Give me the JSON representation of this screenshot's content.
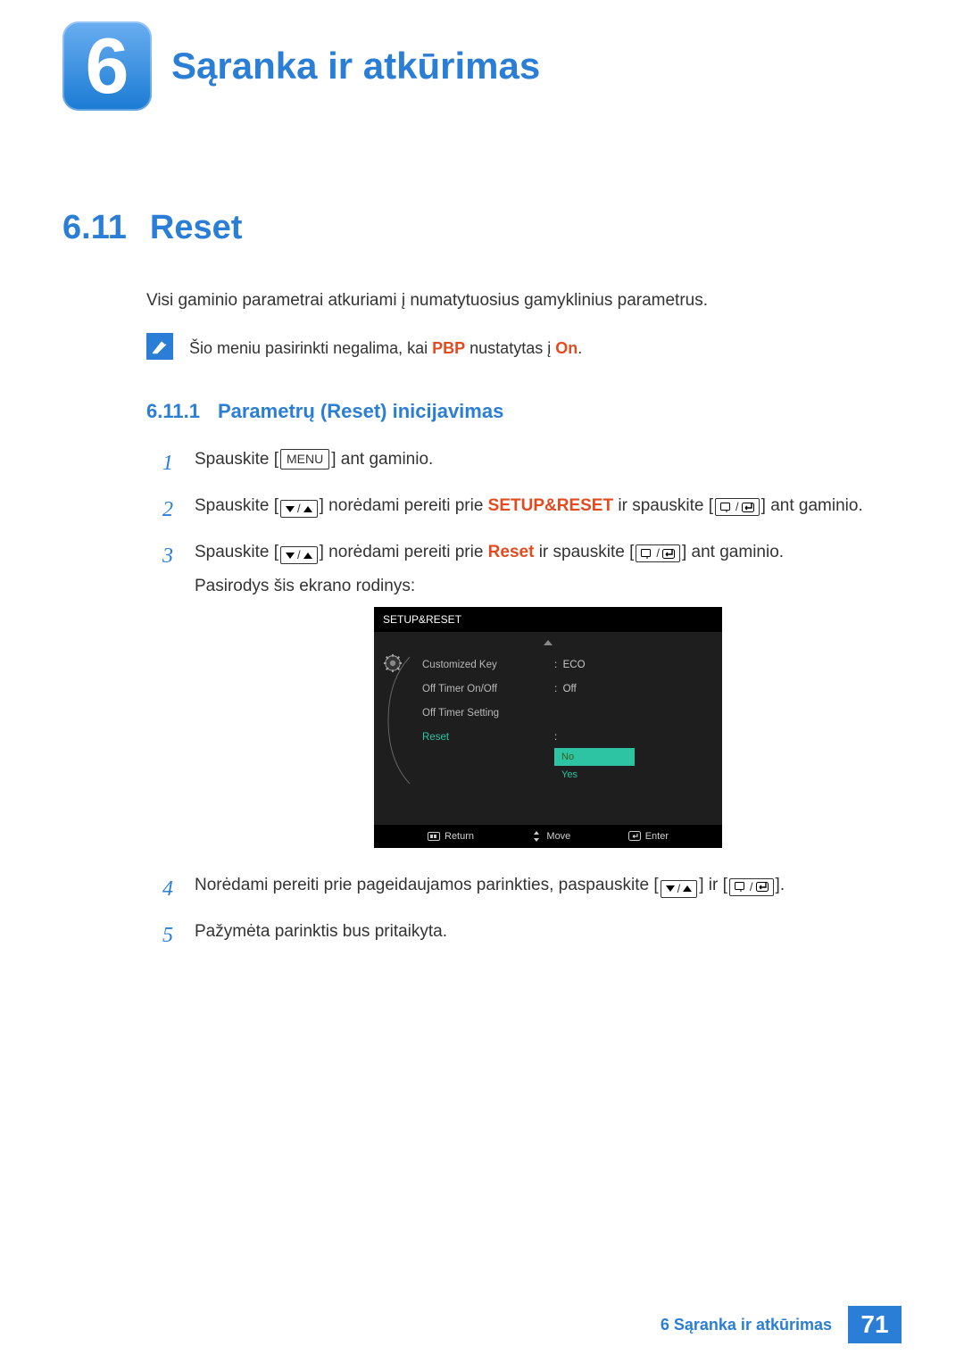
{
  "chapter": {
    "number": "6",
    "title": "Sąranka ir atkūrimas"
  },
  "section": {
    "number": "6.11",
    "title": "Reset"
  },
  "intro": "Visi gaminio parametrai atkuriami į numatytuosius gamyklinius parametrus.",
  "note": {
    "prefix": "Šio meniu pasirinkti negalima, kai ",
    "pbp": "PBP",
    "mid": " nustatytas į ",
    "on": "On",
    "suffix": "."
  },
  "subsection": {
    "number": "6.11.1",
    "title": "Parametrų (Reset) inicijavimas"
  },
  "buttons": {
    "menu": "MENU"
  },
  "steps": {
    "s1_a": "Spauskite [",
    "s1_b": "] ant gaminio.",
    "s2_a": "Spauskite [",
    "s2_b": "] norėdami pereiti prie ",
    "s2_kw": "SETUP&RESET",
    "s2_c": " ir spauskite [",
    "s2_d": "] ant gaminio.",
    "s3_a": "Spauskite [",
    "s3_b": "] norėdami pereiti prie ",
    "s3_kw": "Reset",
    "s3_c": " ir spauskite [",
    "s3_d": "] ant gaminio.",
    "s3_e": "Pasirodys šis ekrano rodinys:",
    "s4_a": "Norėdami pereiti prie pageidaujamos parinkties, paspauskite [",
    "s4_b": "] ir [",
    "s4_c": "].",
    "s5": "Pažymėta parinktis bus pritaikyta."
  },
  "osd": {
    "title": "SETUP&RESET",
    "menu": {
      "customized_key": "Customized Key",
      "off_timer_onoff": "Off Timer On/Off",
      "off_timer_setting": "Off Timer Setting",
      "reset": "Reset"
    },
    "values": {
      "customized_key": "ECO",
      "off_timer_onoff": "Off",
      "sep": ":"
    },
    "reset_options": {
      "no": "No",
      "yes": "Yes"
    },
    "footer": {
      "return": "Return",
      "move": "Move",
      "enter": "Enter"
    }
  },
  "footer": {
    "text": "6 Sąranka ir atkūrimas",
    "page": "71"
  }
}
